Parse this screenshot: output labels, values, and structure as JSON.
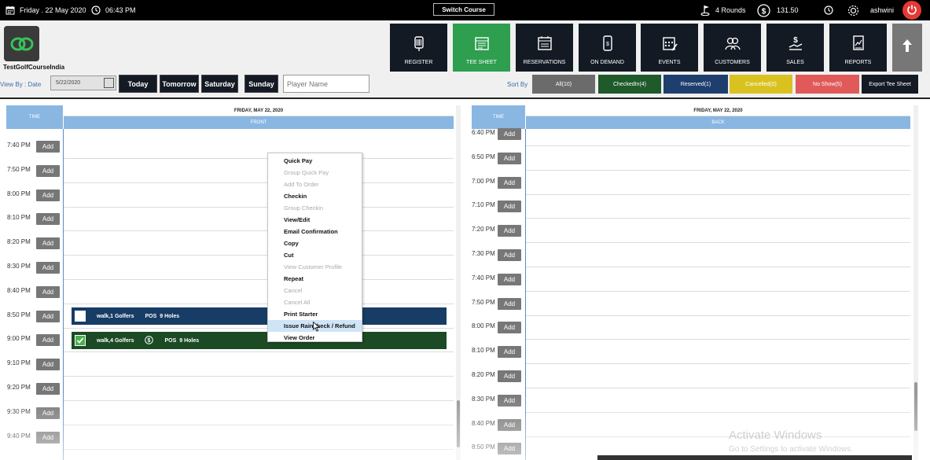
{
  "topbar": {
    "date": "Friday . 22 May 2020",
    "time": "06:43 PM",
    "switch_course": "Switch Course",
    "rounds": "4 Rounds",
    "amount": "131.50",
    "user": "ashwini",
    "icons": [
      "calendar-icon",
      "clock-icon",
      "golf-flag-icon",
      "dollar-icon",
      "clock-icon",
      "gear-icon",
      "power-icon"
    ]
  },
  "brand": {
    "name": "TestGolfCourseIndia",
    "logo_color": "#2e9e4f"
  },
  "nav": [
    {
      "label": "REGISTER",
      "icon": "barcode-scanner-icon"
    },
    {
      "label": "TEE SHEET",
      "icon": "tee-sheet-icon",
      "active": true
    },
    {
      "label": "RESERVATIONS",
      "icon": "calendar-icon"
    },
    {
      "label": "ON DEMAND",
      "icon": "mobile-icon"
    },
    {
      "label": "EVENTS",
      "icon": "events-calendar-icon"
    },
    {
      "label": "CUSTOMERS",
      "icon": "customers-icon"
    },
    {
      "label": "SALES",
      "icon": "sales-icon"
    },
    {
      "label": "REPORTS",
      "icon": "reports-icon"
    }
  ],
  "toolbar": {
    "view_by_label": "View By : Date",
    "date_value": "5/22/2020",
    "days": [
      "Today",
      "Tomorrow",
      "Saturday",
      "Sunday"
    ],
    "player_placeholder": "Player Name",
    "sort_by_label": "Sort By",
    "filters": [
      {
        "label": "All(10)",
        "bg": "#6b6b6b",
        "fg": "#ffffff"
      },
      {
        "label": "CheckedIn(4)",
        "bg": "#1f5a2b",
        "fg": "#ffffff"
      },
      {
        "label": "Reserved(1)",
        "bg": "#1e3f6e",
        "fg": "#ffffff"
      },
      {
        "label": "Cancelled(0)",
        "bg": "#d9c21f",
        "fg": "#ffffff"
      },
      {
        "label": "No Show(5)",
        "bg": "#e05a5a",
        "fg": "#ffffff"
      },
      {
        "label": "Export Tee Sheet",
        "bg": "#141a24",
        "fg": "#ffffff"
      }
    ]
  },
  "front": {
    "time_header": "TIME",
    "date_header": "FRIDAY, MAY 22, 2020",
    "side": "FRONT",
    "add_label": "Add",
    "times": [
      "7:40 PM",
      "7:50 PM",
      "8:00 PM",
      "8:10 PM",
      "8:20 PM",
      "8:30 PM",
      "8:40 PM",
      "8:50 PM",
      "9:00 PM",
      "9:10 PM",
      "9:20 PM",
      "9:30 PM",
      "9:40 PM"
    ],
    "bookings": [
      {
        "label": "walk,1 Golfers",
        "pos": "POS",
        "holes": "9 Holes",
        "color": "#173c66"
      },
      {
        "label": "walk,4 Golfers",
        "pos": "POS",
        "holes": "9 Holes",
        "color": "#1b4a25"
      }
    ]
  },
  "back": {
    "time_header": "TIME",
    "date_header": "FRIDAY, MAY 22, 2020",
    "side": "BACK",
    "add_label": "Add",
    "times": [
      "6:40 PM",
      "6:50 PM",
      "7:00 PM",
      "7:10 PM",
      "7:20 PM",
      "7:30 PM",
      "7:40 PM",
      "7:50 PM",
      "8:00 PM",
      "8:10 PM",
      "8:20 PM",
      "8:30 PM",
      "8:40 PM",
      "8:50 PM"
    ]
  },
  "context_menu": [
    {
      "label": "Quick Pay",
      "enabled": true
    },
    {
      "label": "Group Quick Pay",
      "enabled": false
    },
    {
      "label": "Add To Order",
      "enabled": false
    },
    {
      "label": "Checkin",
      "enabled": true
    },
    {
      "label": "Group Checkin",
      "enabled": false
    },
    {
      "label": "View/Edit",
      "enabled": true
    },
    {
      "label": "Email Confirmation",
      "enabled": true
    },
    {
      "label": "Copy",
      "enabled": true
    },
    {
      "label": "Cut",
      "enabled": true
    },
    {
      "label": "View Customer Profile",
      "enabled": false
    },
    {
      "label": "Repeat",
      "enabled": true
    },
    {
      "label": "Cancel",
      "enabled": false
    },
    {
      "label": "Cancel All",
      "enabled": false
    },
    {
      "label": "Print Starter",
      "enabled": true
    },
    {
      "label": "Issue Raincheck / Refund",
      "enabled": true,
      "hover": true
    },
    {
      "label": "View Order",
      "enabled": true
    }
  ],
  "watermark": {
    "line1": "Activate Windows",
    "line2": "Go to Settings to activate Windows."
  }
}
